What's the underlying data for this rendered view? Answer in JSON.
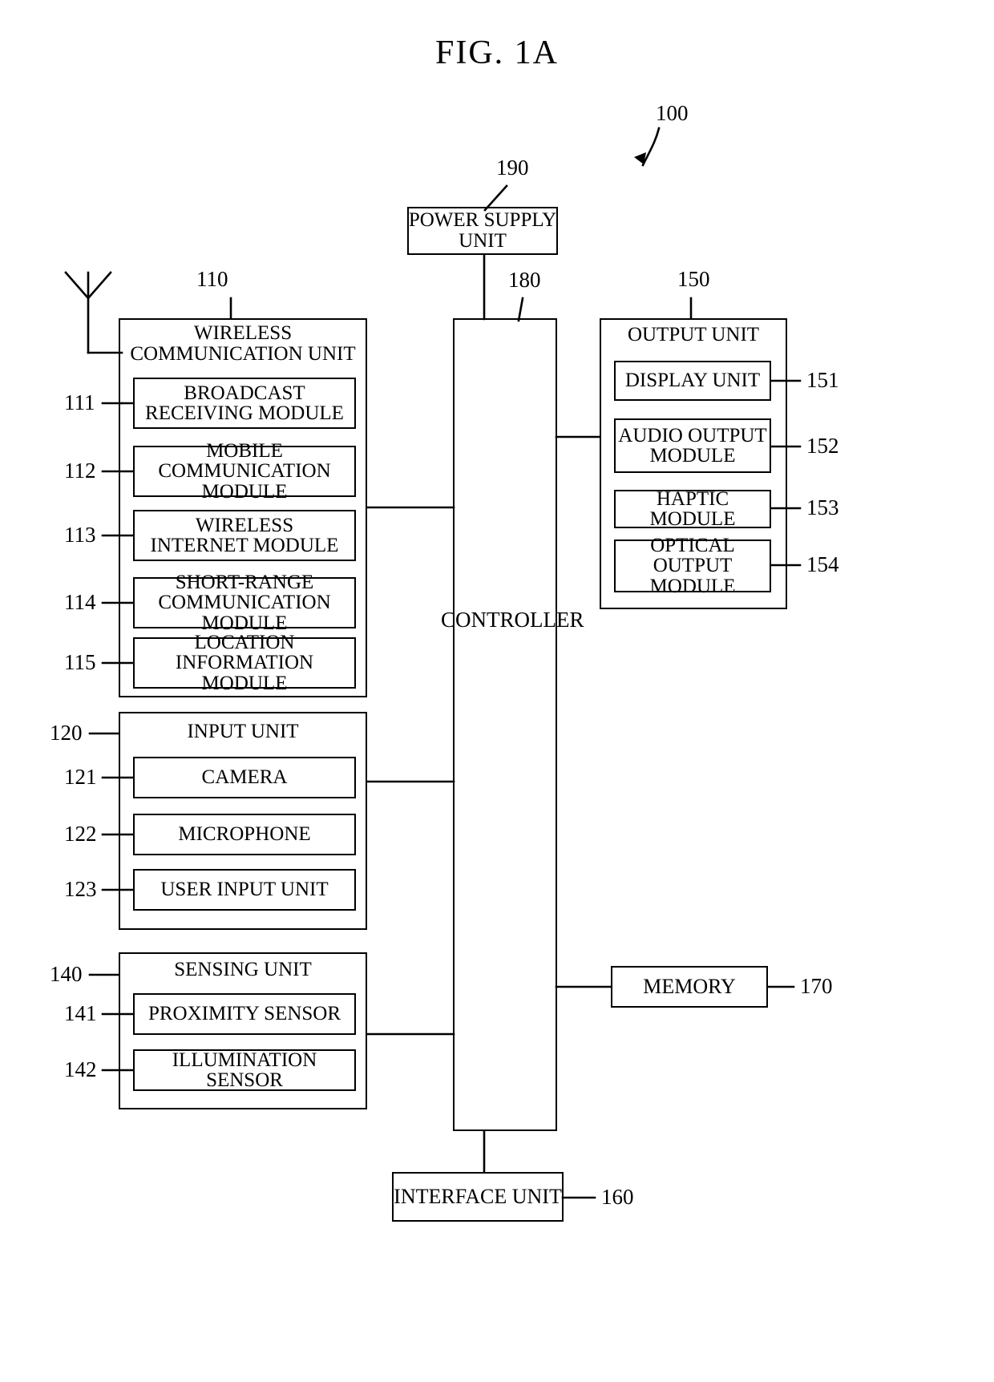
{
  "figure": {
    "title": "FIG. 1A",
    "device_ref": "100"
  },
  "blocks": {
    "power_supply": {
      "label": "POWER SUPPLY\nUNIT",
      "ref": "190"
    },
    "controller": {
      "label": "CONTROLLER",
      "ref": "180"
    },
    "memory": {
      "label": "MEMORY",
      "ref": "170"
    },
    "interface": {
      "label": "INTERFACE UNIT",
      "ref": "160"
    }
  },
  "wireless_unit": {
    "title": "WIRELESS\nCOMMUNICATION UNIT",
    "ref": "110",
    "modules": [
      {
        "label": "BROADCAST\nRECEIVING MODULE",
        "ref": "111"
      },
      {
        "label": "MOBILE\nCOMMUNICATION MODULE",
        "ref": "112"
      },
      {
        "label": "WIRELESS\nINTERNET MODULE",
        "ref": "113"
      },
      {
        "label": "SHORT-RANGE\nCOMMUNICATION MODULE",
        "ref": "114"
      },
      {
        "label": "LOCATION\nINFORMATION MODULE",
        "ref": "115"
      }
    ]
  },
  "input_unit": {
    "title": "INPUT UNIT",
    "ref": "120",
    "modules": [
      {
        "label": "CAMERA",
        "ref": "121"
      },
      {
        "label": "MICROPHONE",
        "ref": "122"
      },
      {
        "label": "USER INPUT UNIT",
        "ref": "123"
      }
    ]
  },
  "sensing_unit": {
    "title": "SENSING UNIT",
    "ref": "140",
    "modules": [
      {
        "label": "PROXIMITY SENSOR",
        "ref": "141"
      },
      {
        "label": "ILLUMINATION SENSOR",
        "ref": "142"
      }
    ]
  },
  "output_unit": {
    "title": "OUTPUT UNIT",
    "ref": "150",
    "modules": [
      {
        "label": "DISPLAY UNIT",
        "ref": "151"
      },
      {
        "label": "AUDIO OUTPUT\nMODULE",
        "ref": "152"
      },
      {
        "label": "HAPTIC MODULE",
        "ref": "153"
      },
      {
        "label": "OPTICAL OUTPUT\nMODULE",
        "ref": "154"
      }
    ]
  },
  "icons": {
    "antenna": "antenna-icon",
    "pointer_arrow": "device-pointer-arrow-icon"
  },
  "colors": {
    "line": "#000000",
    "background": "#ffffff"
  }
}
